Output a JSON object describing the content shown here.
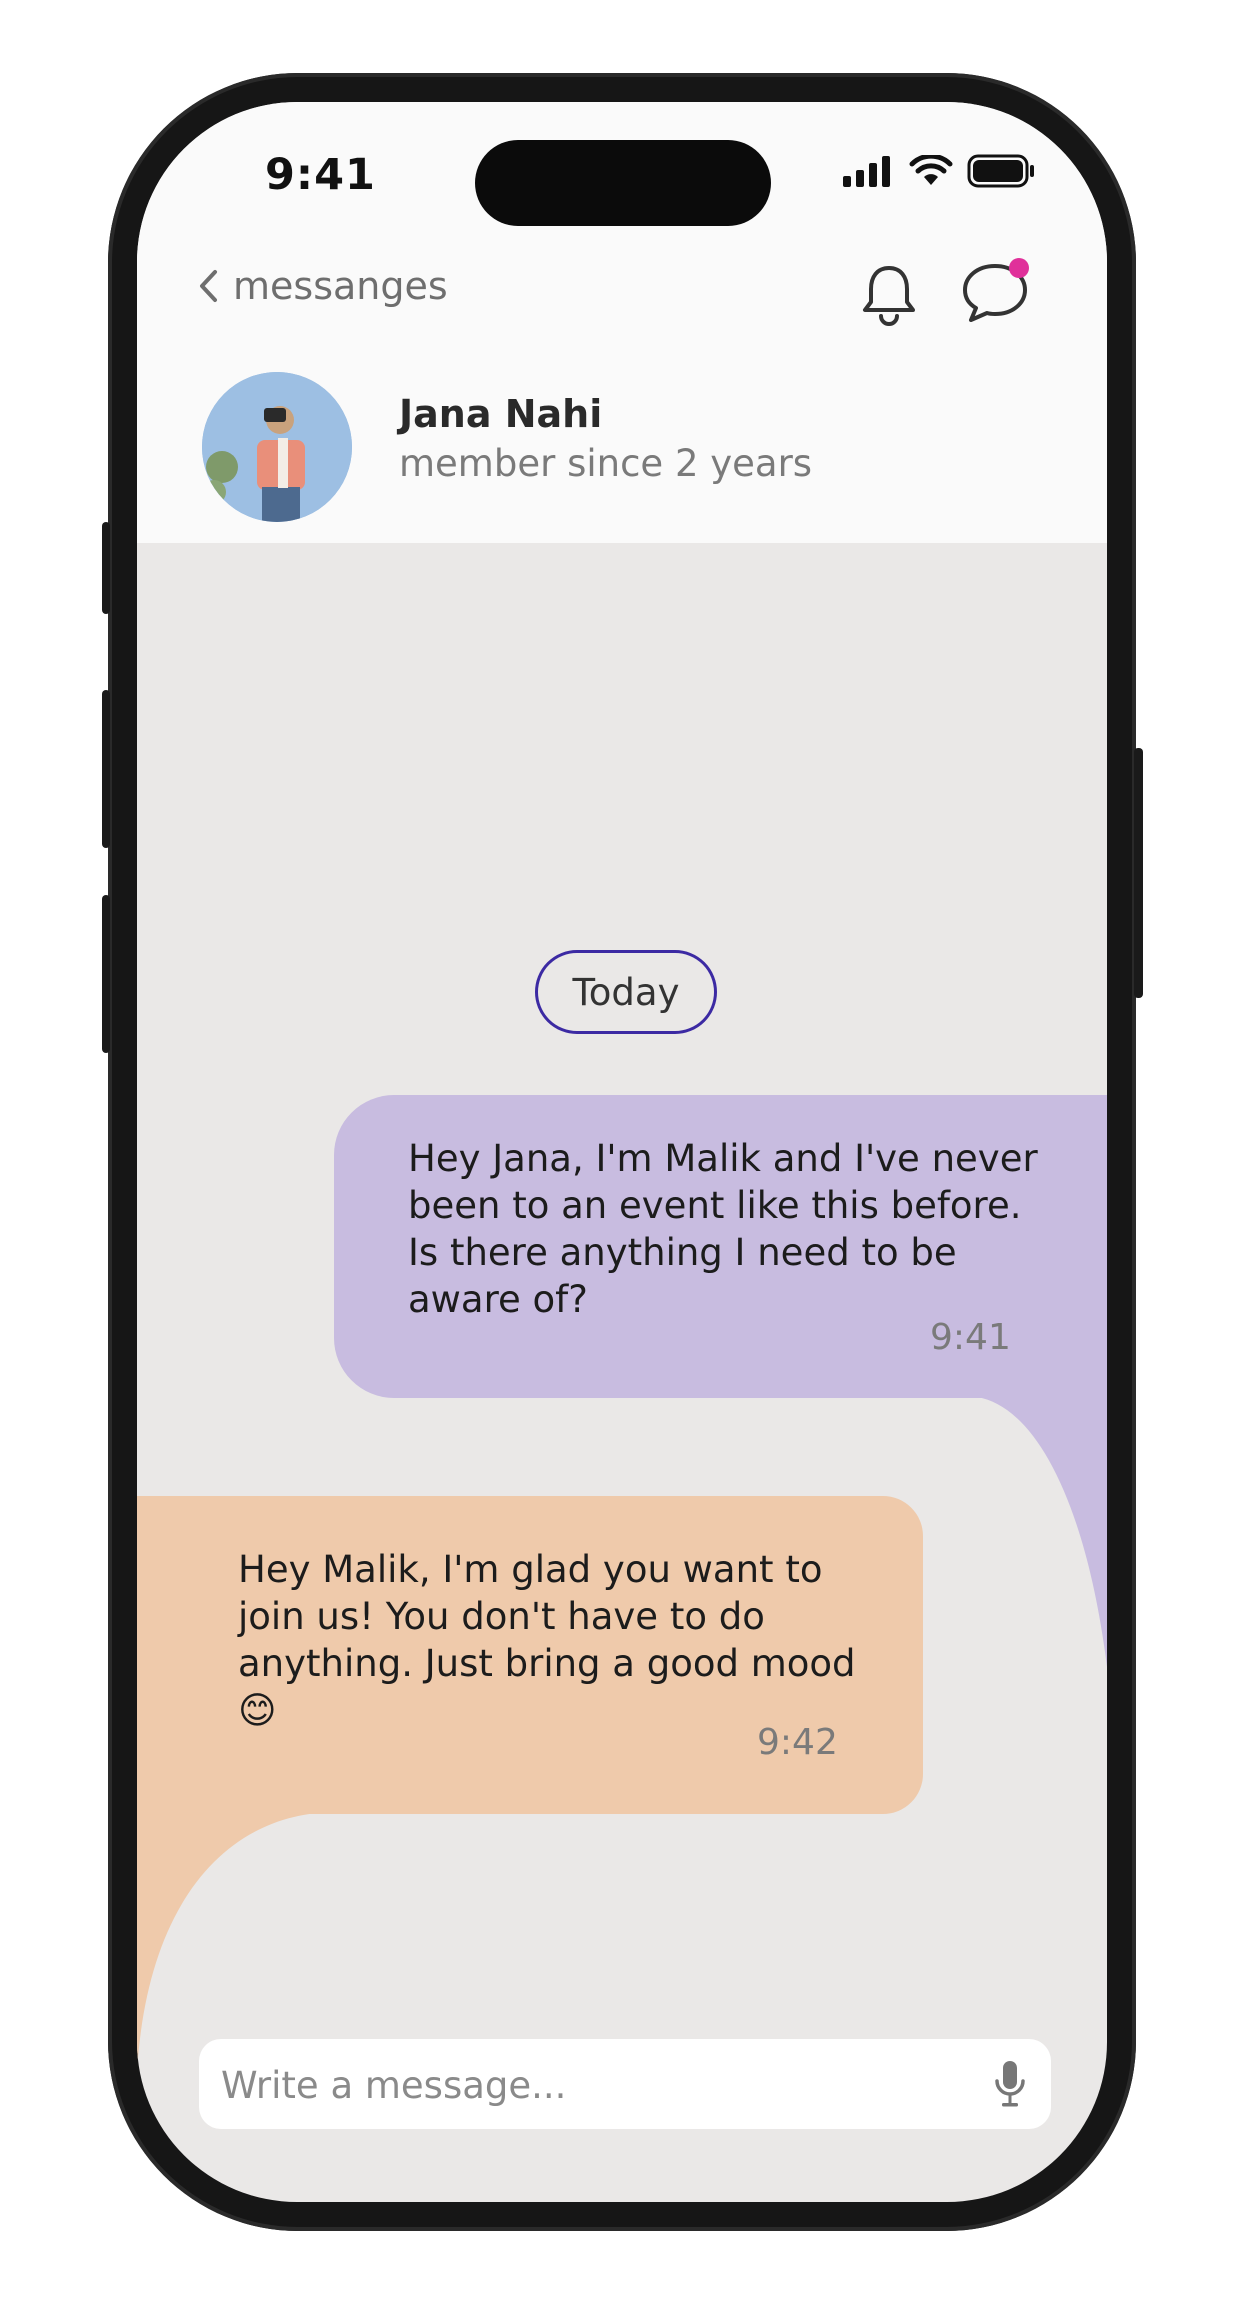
{
  "status_bar": {
    "time": "9:41"
  },
  "header": {
    "back_label": "messanges",
    "contact_name": "Jana Nahi",
    "contact_subtitle": "member since 2 years",
    "icons": [
      "chevron-left-icon",
      "bell-icon",
      "chat-icon"
    ],
    "notification_dot_color": "#e0309a"
  },
  "conversation": {
    "date_divider": "Today",
    "messages": [
      {
        "direction": "outgoing",
        "text": "Hey Jana, I'm Malik and I've never been to an event like this before. Is there anything I need to be aware of?",
        "time": "9:41",
        "color": "#c8bce0"
      },
      {
        "direction": "incoming",
        "text": "Hey Malik, I'm glad you want to join us! You don't have to do anything. Just bring a good mood 😊",
        "time": "9:42",
        "color": "#efcaab"
      }
    ]
  },
  "composer": {
    "placeholder": "Write a message...",
    "icon": "microphone-icon"
  },
  "colors": {
    "accent": "#3c2aa3",
    "chat_background": "#eae8e7"
  }
}
